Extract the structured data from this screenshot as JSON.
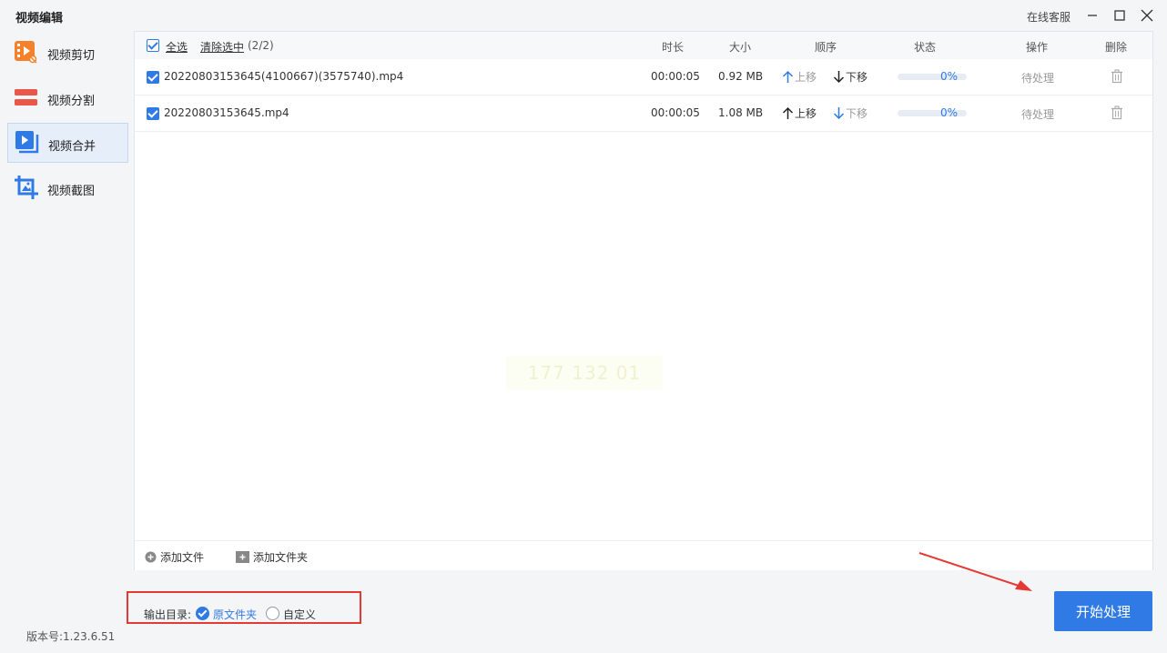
{
  "app": {
    "title": "视频编辑",
    "support": "在线客服",
    "version": "版本号:1.23.6.51"
  },
  "sidebar": {
    "items": [
      {
        "label": "视频剪切",
        "icon": "video-cut-icon",
        "color": "#f5822a"
      },
      {
        "label": "视频分割",
        "icon": "video-split-icon",
        "color": "#e9574b"
      },
      {
        "label": "视频合并",
        "icon": "video-merge-icon",
        "color": "#2f7ae5",
        "active": true
      },
      {
        "label": "视频截图",
        "icon": "video-screenshot-icon",
        "color": "#2f7ae5"
      }
    ]
  },
  "table": {
    "select_all": "全选",
    "clear_selected": "清除选中",
    "selected_count": "(2/2)",
    "columns": {
      "duration": "时长",
      "size": "大小",
      "order": "顺序",
      "status": "状态",
      "action": "操作",
      "delete": "删除"
    },
    "move_up": "上移",
    "move_down": "下移",
    "rows": [
      {
        "name": "20220803153645(4100667)(3575740).mp4",
        "duration": "00:00:05",
        "size": "0.92 MB",
        "progress": "0%",
        "progress_value": 0,
        "action": "待处理",
        "up_enabled": false,
        "down_enabled": true
      },
      {
        "name": "20220803153645.mp4",
        "duration": "00:00:05",
        "size": "1.08 MB",
        "progress": "0%",
        "progress_value": 0,
        "action": "待处理",
        "up_enabled": true,
        "down_enabled": false
      }
    ]
  },
  "footer": {
    "add_file": "添加文件",
    "add_folder": "添加文件夹"
  },
  "output": {
    "label": "输出目录:",
    "option_original": "原文件夹",
    "option_custom": "自定义",
    "selected": "原文件夹"
  },
  "start_button": "开始处理",
  "watermark": "177 132 01",
  "colors": {
    "accent": "#2f7ae5",
    "highlight": "#e53935"
  }
}
